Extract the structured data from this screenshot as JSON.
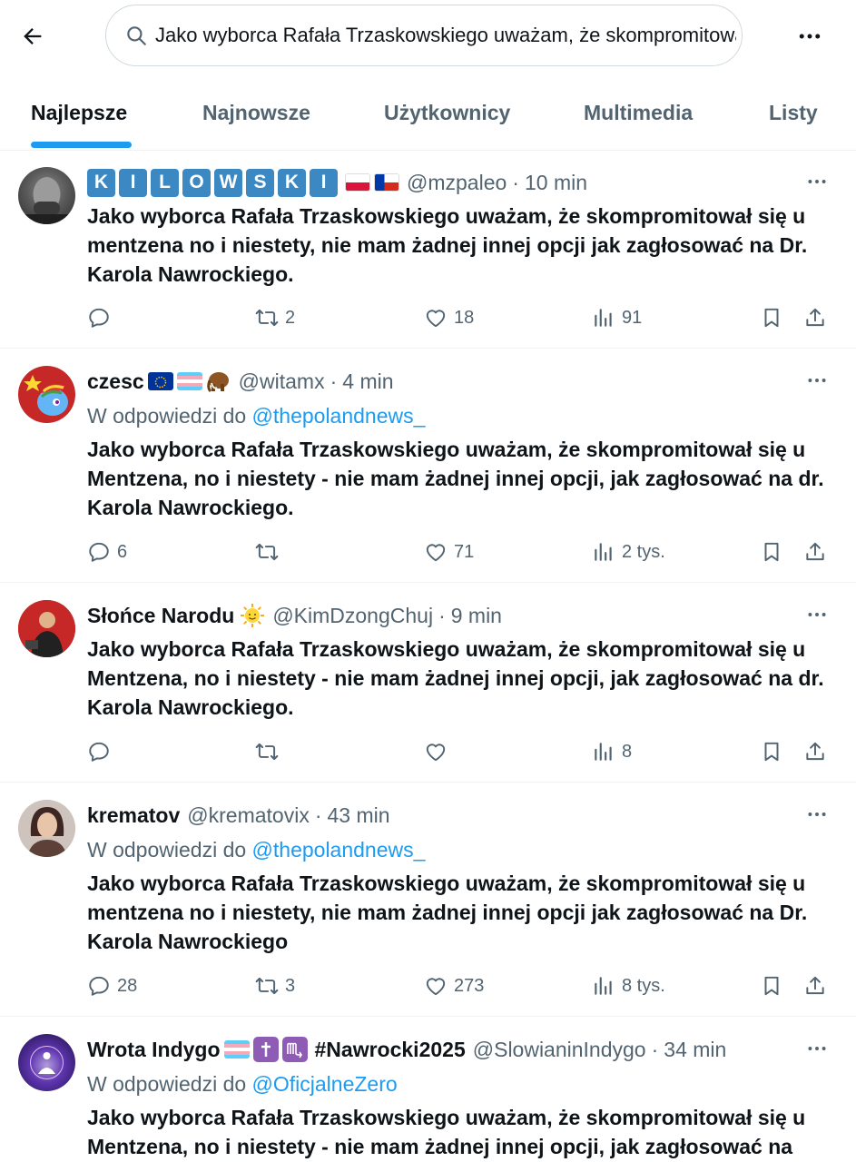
{
  "search": {
    "query": "Jako wyborca Rafała Trzaskowskiego uważam, że skompromitował się u"
  },
  "tabs": [
    {
      "label": "Najlepsze",
      "active": true
    },
    {
      "label": "Najnowsze",
      "active": false
    },
    {
      "label": "Użytkownicy",
      "active": false
    },
    {
      "label": "Multimedia",
      "active": false
    },
    {
      "label": "Listy",
      "active": false
    }
  ],
  "colors": {
    "accent": "#1d9bf0",
    "text": "#0f1419",
    "muted": "#536471",
    "border": "#eff3f4"
  },
  "tweets": [
    {
      "name_letters": [
        "K",
        "I",
        "L",
        "O",
        "W",
        "S",
        "K",
        "I"
      ],
      "name_emojis": [
        "flag-poland",
        "flag-chile"
      ],
      "handle": "@mzpaleo",
      "dot": "·",
      "time": "10 min",
      "reply_to_prefix": "",
      "reply_to_link": "",
      "text": "Jako wyborca Rafała Trzaskowskiego uważam, że skompromitował się u mentzena no i niestety, nie mam żadnej innej opcji jak zagłosować na Dr. Karola Nawrockiego.",
      "replies": "",
      "retweets": "2",
      "likes": "18",
      "views": "91"
    },
    {
      "name": "czesc",
      "name_emojis": [
        "flag-eu",
        "flag-transgender",
        "mammoth"
      ],
      "handle": "@witamx",
      "dot": "·",
      "time": "4 min",
      "reply_to_prefix": "W odpowiedzi do ",
      "reply_to_link": "@thepolandnews_",
      "text": "Jako wyborca Rafała Trzaskowskiego uważam, że skompromitował się u Mentzena, no i niestety - nie mam żadnej innej opcji, jak zagłosować na dr. Karola Nawrockiego.",
      "replies": "6",
      "retweets": "",
      "likes": "71",
      "views": "2 tys."
    },
    {
      "name": "Słońce Narodu",
      "name_emojis": [
        "sun-with-face"
      ],
      "handle": "@KimDzongChuj",
      "dot": "·",
      "time": "9 min",
      "reply_to_prefix": "",
      "reply_to_link": "",
      "text": "Jako wyborca Rafała Trzaskowskiego uważam, że skompromitował się u Mentzena, no i niestety - nie mam żadnej innej opcji, jak zagłosować na dr. Karola Nawrockiego.",
      "replies": "",
      "retweets": "",
      "likes": "",
      "views": "8"
    },
    {
      "name": "krematov",
      "name_emojis": [],
      "handle": "@krematovix",
      "dot": "·",
      "time": "43 min",
      "reply_to_prefix": "W odpowiedzi do ",
      "reply_to_link": "@thepolandnews_",
      "text": "Jako wyborca Rafała Trzaskowskiego uważam, że skompromitował się u mentzena no i niestety, nie mam żadnej innej opcji jak zagłosować na Dr. Karola Nawrockiego",
      "replies": "28",
      "retweets": "3",
      "likes": "273",
      "views": "8 tys."
    },
    {
      "name": "Wrota Indygo",
      "name_emojis": [
        "flag-transgender",
        "latin-cross",
        "scorpio"
      ],
      "name_suffix": "#Nawrocki2025",
      "handle": "@SlowianinIndygo",
      "dot": "·",
      "time": "34 min",
      "reply_to_prefix": "W odpowiedzi do ",
      "reply_to_link": "@OficjalneZero",
      "text": "Jako wyborca Rafała Trzaskowskiego uważam, że skompromitował się u Mentzena, no i niestety - nie mam żadnej innej opcji, jak zagłosować na",
      "replies": "",
      "retweets": "",
      "likes": "",
      "views": ""
    }
  ]
}
